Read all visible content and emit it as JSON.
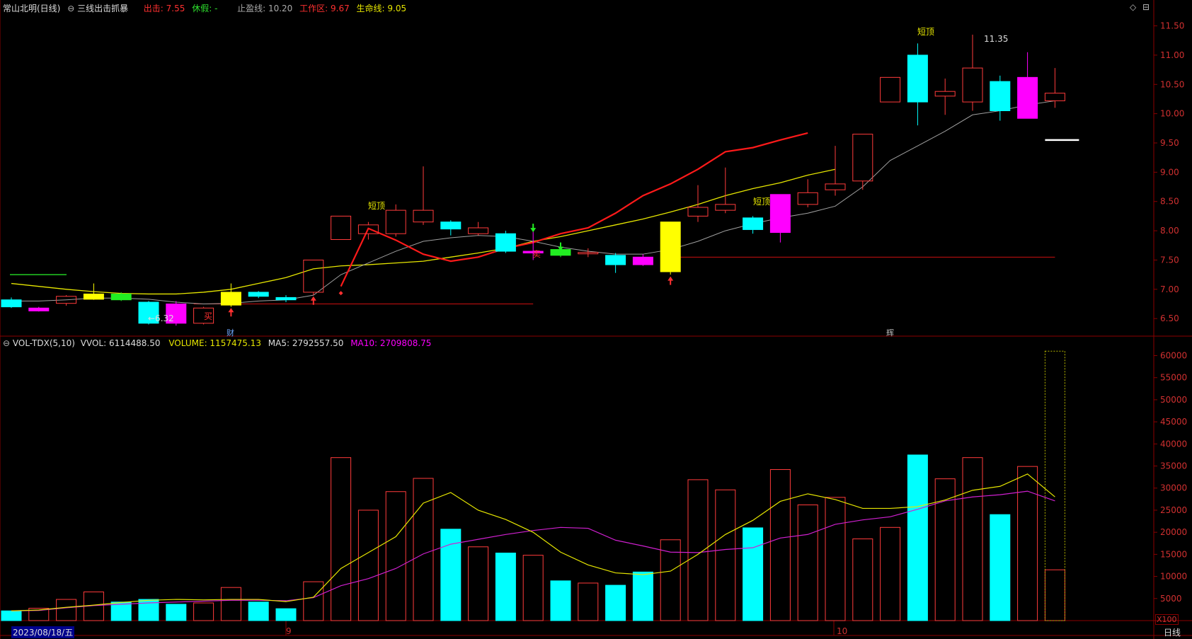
{
  "header": {
    "stock_title": "常山北明(日线)",
    "indicator_name": "三线出击抓暴",
    "sell_label": "出击:",
    "sell_value": "7.55",
    "rest_label": "休假:",
    "rest_value": "-",
    "take_profit_label": "止盈线:",
    "take_profit_value": "10.20",
    "work_zone_label": "工作区:",
    "work_zone_value": "9.67",
    "life_line_label": "生命线:",
    "life_line_value": "9.05"
  },
  "volume_header": {
    "name": "VOL-TDX(5,10)",
    "vvol": "VVOL: 6114488.50",
    "volume": "VOLUME: 1157475.13",
    "ma5": "MA5: 2792557.50",
    "ma10": "MA10: 2709808.75"
  },
  "footer": {
    "date": "2023/08/18/五",
    "period": "日线",
    "scale": "X100",
    "month_9": "9",
    "month_10": "10"
  },
  "markers": {
    "cai": "财",
    "hui": "辉",
    "low_label": "←6.32",
    "high_label": "11.35",
    "short_top": "短顶",
    "buy": "买",
    "sell": "卖"
  },
  "colors": {
    "up": "#ff3b3b",
    "down": "#00ffff",
    "magenta": "#ff00ff",
    "yellow": "#ffff00",
    "ma_gray": "#a0a0a0",
    "ma_red": "#ff1a1a",
    "ma_yellow": "#e6e600",
    "grid": "#8b0000",
    "axis_text": "#d03030"
  },
  "chart_data": [
    {
      "type": "candlestick",
      "ylim": [
        6.2,
        11.7
      ],
      "yticks": [
        6.5,
        7.0,
        7.5,
        8.0,
        8.5,
        9.0,
        9.5,
        10.0,
        10.5,
        11.0,
        11.5
      ],
      "candles": [
        {
          "o": 6.82,
          "h": 6.86,
          "l": 6.68,
          "c": 6.7,
          "k": "down"
        },
        {
          "o": 6.68,
          "h": 6.7,
          "l": 6.62,
          "c": 6.63,
          "k": "mag"
        },
        {
          "o": 6.76,
          "h": 6.9,
          "l": 6.72,
          "c": 6.88,
          "k": "up"
        },
        {
          "o": 6.83,
          "h": 7.1,
          "l": 6.82,
          "c": 6.92,
          "k": "yel"
        },
        {
          "o": 6.92,
          "h": 6.95,
          "l": 6.8,
          "c": 6.82,
          "k": "grn"
        },
        {
          "o": 6.78,
          "h": 6.8,
          "l": 6.4,
          "c": 6.42,
          "k": "down"
        },
        {
          "o": 6.75,
          "h": 6.8,
          "l": 6.38,
          "c": 6.42,
          "k": "mag"
        },
        {
          "o": 6.42,
          "h": 6.7,
          "l": 6.4,
          "c": 6.68,
          "k": "up"
        },
        {
          "o": 6.73,
          "h": 7.1,
          "l": 6.7,
          "c": 6.95,
          "k": "yel"
        },
        {
          "o": 6.95,
          "h": 6.97,
          "l": 6.85,
          "c": 6.88,
          "k": "down"
        },
        {
          "o": 6.86,
          "h": 6.9,
          "l": 6.78,
          "c": 6.82,
          "k": "down"
        },
        {
          "o": 6.95,
          "h": 7.5,
          "l": 6.9,
          "c": 7.5,
          "k": "up"
        },
        {
          "o": 7.85,
          "h": 8.25,
          "l": 7.85,
          "c": 8.25,
          "k": "up"
        },
        {
          "o": 7.95,
          "h": 8.15,
          "l": 7.85,
          "c": 8.1,
          "k": "up"
        },
        {
          "o": 7.95,
          "h": 8.45,
          "l": 7.9,
          "c": 8.35,
          "k": "up"
        },
        {
          "o": 8.15,
          "h": 9.1,
          "l": 8.1,
          "c": 8.35,
          "k": "up"
        },
        {
          "o": 8.15,
          "h": 8.18,
          "l": 7.92,
          "c": 8.03,
          "k": "down"
        },
        {
          "o": 7.95,
          "h": 8.15,
          "l": 7.92,
          "c": 8.05,
          "k": "up"
        },
        {
          "o": 7.95,
          "h": 8.0,
          "l": 7.62,
          "c": 7.65,
          "k": "down"
        },
        {
          "o": 7.65,
          "h": 8.0,
          "l": 7.5,
          "c": 7.62,
          "k": "mag"
        },
        {
          "o": 7.68,
          "h": 7.72,
          "l": 7.55,
          "c": 7.58,
          "k": "grn"
        },
        {
          "o": 7.63,
          "h": 7.7,
          "l": 7.55,
          "c": 7.62,
          "k": "up"
        },
        {
          "o": 7.58,
          "h": 7.62,
          "l": 7.28,
          "c": 7.42,
          "k": "down"
        },
        {
          "o": 7.55,
          "h": 7.6,
          "l": 7.4,
          "c": 7.42,
          "k": "mag"
        },
        {
          "o": 7.3,
          "h": 8.15,
          "l": 7.25,
          "c": 8.15,
          "k": "yel"
        },
        {
          "o": 8.25,
          "h": 8.78,
          "l": 8.15,
          "c": 8.4,
          "k": "up"
        },
        {
          "o": 8.35,
          "h": 9.08,
          "l": 8.3,
          "c": 8.45,
          "k": "up"
        },
        {
          "o": 8.22,
          "h": 8.25,
          "l": 7.95,
          "c": 8.02,
          "k": "down"
        },
        {
          "o": 7.97,
          "h": 8.62,
          "l": 7.8,
          "c": 8.62,
          "k": "mag"
        },
        {
          "o": 8.45,
          "h": 8.88,
          "l": 8.4,
          "c": 8.65,
          "k": "up"
        },
        {
          "o": 8.7,
          "h": 9.45,
          "l": 8.6,
          "c": 8.8,
          "k": "up"
        },
        {
          "o": 8.85,
          "h": 9.65,
          "l": 8.7,
          "c": 9.65,
          "k": "up"
        },
        {
          "o": 10.2,
          "h": 10.62,
          "l": 10.2,
          "c": 10.62,
          "k": "up"
        },
        {
          "o": 11.0,
          "h": 11.2,
          "l": 9.8,
          "c": 10.2,
          "k": "down"
        },
        {
          "o": 10.38,
          "h": 10.6,
          "l": 9.98,
          "c": 10.3,
          "k": "up"
        },
        {
          "o": 10.2,
          "h": 11.35,
          "l": 10.05,
          "c": 10.78,
          "k": "up"
        },
        {
          "o": 10.55,
          "h": 10.65,
          "l": 9.88,
          "c": 10.05,
          "k": "down"
        },
        {
          "o": 10.62,
          "h": 11.05,
          "l": 9.92,
          "c": 9.92,
          "k": "mag"
        },
        {
          "o": 10.22,
          "h": 10.78,
          "l": 10.1,
          "c": 10.35,
          "k": "up"
        }
      ],
      "ma_gray": [
        6.8,
        6.8,
        6.82,
        6.85,
        6.85,
        6.83,
        6.78,
        6.75,
        6.76,
        6.8,
        6.82,
        6.9,
        7.25,
        7.45,
        7.65,
        7.82,
        7.88,
        7.92,
        7.9,
        7.82,
        7.72,
        7.65,
        7.6,
        7.6,
        7.68,
        7.82,
        8.0,
        8.12,
        8.22,
        8.3,
        8.42,
        8.75,
        9.2,
        9.45,
        9.7,
        9.98,
        10.05,
        10.15,
        10.22
      ],
      "ma_red": [
        7.05,
        8.04,
        7.84,
        7.6,
        7.48,
        7.55,
        7.7,
        7.8,
        7.95,
        8.05,
        8.3,
        8.6,
        8.8,
        9.05,
        9.35,
        9.42,
        9.55,
        9.67
      ],
      "ma_yellow": [
        7.1,
        7.05,
        7.0,
        6.96,
        6.93,
        6.92,
        6.92,
        6.95,
        7.0,
        7.1,
        7.2,
        7.35,
        7.4,
        7.42,
        7.45,
        7.48,
        7.55,
        7.62,
        7.7,
        7.82,
        7.9,
        8.0,
        8.1,
        8.2,
        8.32,
        8.45,
        8.6,
        8.72,
        8.82,
        8.95,
        9.05
      ],
      "green_line": 7.25,
      "red_level_1": 6.75,
      "red_level_2": 7.55,
      "white_mark": 9.55,
      "low_price": 6.32,
      "high_price": 11.35
    },
    {
      "type": "bar",
      "ylim": [
        0,
        62000
      ],
      "yticks": [
        5000,
        10000,
        15000,
        20000,
        25000,
        30000,
        35000,
        40000,
        45000,
        50000,
        55000,
        60000
      ],
      "volumes": [
        2200,
        2800,
        4800,
        6500,
        4200,
        4800,
        3700,
        4000,
        7500,
        4200,
        2700,
        8800,
        36900,
        25000,
        29200,
        32200,
        20700,
        16700,
        15300,
        14800,
        9000,
        8500,
        8000,
        11000,
        18300,
        31900,
        29600,
        21000,
        34200,
        26200,
        27900,
        18500,
        21100,
        37500,
        32100,
        36900,
        24000,
        34900,
        11500
      ],
      "vol_kind": [
        "down",
        "up",
        "up",
        "up",
        "down",
        "down",
        "down",
        "up",
        "up",
        "down",
        "down",
        "up",
        "up",
        "up",
        "up",
        "up",
        "down",
        "up",
        "down",
        "up",
        "down",
        "up",
        "down",
        "down",
        "up",
        "up",
        "up",
        "down",
        "up",
        "up",
        "up",
        "up",
        "up",
        "down",
        "up",
        "up",
        "down",
        "up",
        "up"
      ],
      "ma5": [
        2200,
        2400,
        3000,
        3500,
        4100,
        4600,
        4800,
        4700,
        4800,
        4800,
        4300,
        5300,
        11800,
        15400,
        19000,
        26600,
        29000,
        25000,
        22900,
        20000,
        15500,
        12600,
        10800,
        10400,
        11200,
        15000,
        19500,
        22700,
        27000,
        28700,
        27400,
        25400,
        25400,
        25800,
        27300,
        29500,
        30400,
        33200,
        28000
      ],
      "ma10": [
        2200,
        2300,
        2900,
        3400,
        3700,
        4000,
        4200,
        4400,
        4600,
        4600,
        4500,
        5200,
        7900,
        9500,
        11800,
        15100,
        17300,
        18400,
        19500,
        20400,
        21100,
        20900,
        18200,
        16900,
        15500,
        15400,
        16100,
        16500,
        18700,
        19500,
        21800,
        22800,
        23500,
        25200,
        27100,
        28000,
        28500,
        29300,
        27100
      ],
      "last_outline": 61000
    }
  ]
}
